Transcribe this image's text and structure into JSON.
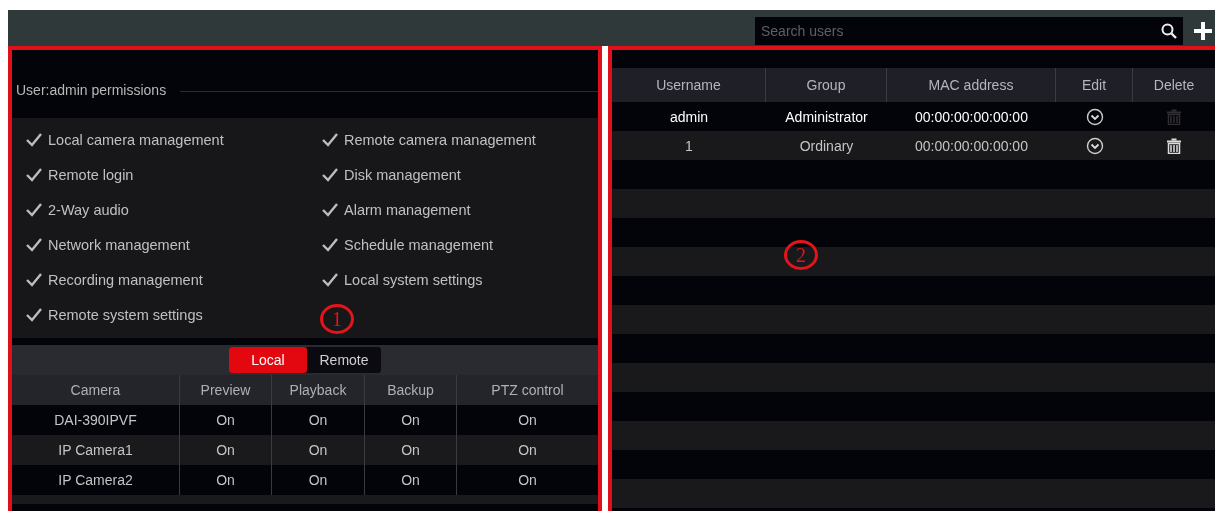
{
  "search": {
    "placeholder": "Search users"
  },
  "permissions": {
    "title": "User:admin permissions",
    "items": [
      {
        "label": "Local camera management",
        "checked": true
      },
      {
        "label": "Remote camera management",
        "checked": true
      },
      {
        "label": "Remote login",
        "checked": true
      },
      {
        "label": "Disk management",
        "checked": true
      },
      {
        "label": "2-Way audio",
        "checked": true
      },
      {
        "label": "Alarm management",
        "checked": true
      },
      {
        "label": "Network management",
        "checked": true
      },
      {
        "label": "Schedule management",
        "checked": true
      },
      {
        "label": "Recording management",
        "checked": true
      },
      {
        "label": "Local system settings",
        "checked": true
      },
      {
        "label": "Remote system settings",
        "checked": true
      }
    ]
  },
  "tabs": [
    {
      "label": "Local",
      "selected": true
    },
    {
      "label": "Remote",
      "selected": false
    }
  ],
  "camera_table": {
    "columns": [
      "Camera",
      "Preview",
      "Playback",
      "Backup",
      "PTZ control"
    ],
    "rows": [
      [
        "DAI-390IPVF",
        "On",
        "On",
        "On",
        "On"
      ],
      [
        "IP Camera1",
        "On",
        "On",
        "On",
        "On"
      ],
      [
        "IP Camera2",
        "On",
        "On",
        "On",
        "On"
      ]
    ]
  },
  "user_table": {
    "columns": [
      "Username",
      "Group",
      "MAC address",
      "Edit",
      "Delete"
    ],
    "rows": [
      {
        "username": "admin",
        "group": "Administrator",
        "mac": "00:00:00:00:00:00",
        "selected": true,
        "delete_disabled": true
      },
      {
        "username": "1",
        "group": "Ordinary",
        "mac": "00:00:00:00:00:00",
        "selected": false,
        "delete_disabled": false
      }
    ]
  },
  "callouts": [
    {
      "label": "1"
    },
    {
      "label": "2"
    }
  ]
}
